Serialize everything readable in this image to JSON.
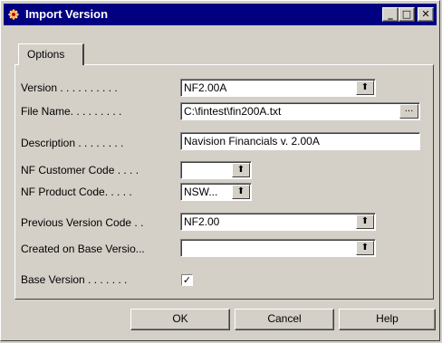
{
  "window": {
    "title": "Import Version",
    "minimize_glyph": "_",
    "maximize_glyph": "□",
    "close_glyph": "✕",
    "icon": "app-icon"
  },
  "tabs": [
    {
      "label": "Options"
    }
  ],
  "fields": {
    "version": {
      "label": "Version . . . . . . . . . .",
      "value": "NF2.00A"
    },
    "file_name": {
      "label": "File Name. . . . . . . . .",
      "value": "C:\\fintest\\fin200A.txt"
    },
    "description": {
      "label": "Description . . . . . . . .",
      "value": "Navision Financials v. 2.00A"
    },
    "nf_customer_code": {
      "label": "NF Customer Code . . . .",
      "value": ""
    },
    "nf_product_code": {
      "label": "NF Product Code. . . . .",
      "value": "NSW..."
    },
    "previous_version_code": {
      "label": "Previous Version Code . .",
      "value": "NF2.00"
    },
    "created_on_base_version": {
      "label": "Created on Base Versio...",
      "value": ""
    },
    "base_version": {
      "label": "Base Version . . . . . . .",
      "checked": true,
      "glyph": "✓"
    }
  },
  "controls": {
    "dropdown_glyph": "⬆",
    "assist_glyph": "..."
  },
  "buttons": {
    "ok": "OK",
    "cancel": "Cancel",
    "help": "Help"
  },
  "colors": {
    "titlebar": "#000080",
    "face": "#d4d0c8"
  }
}
